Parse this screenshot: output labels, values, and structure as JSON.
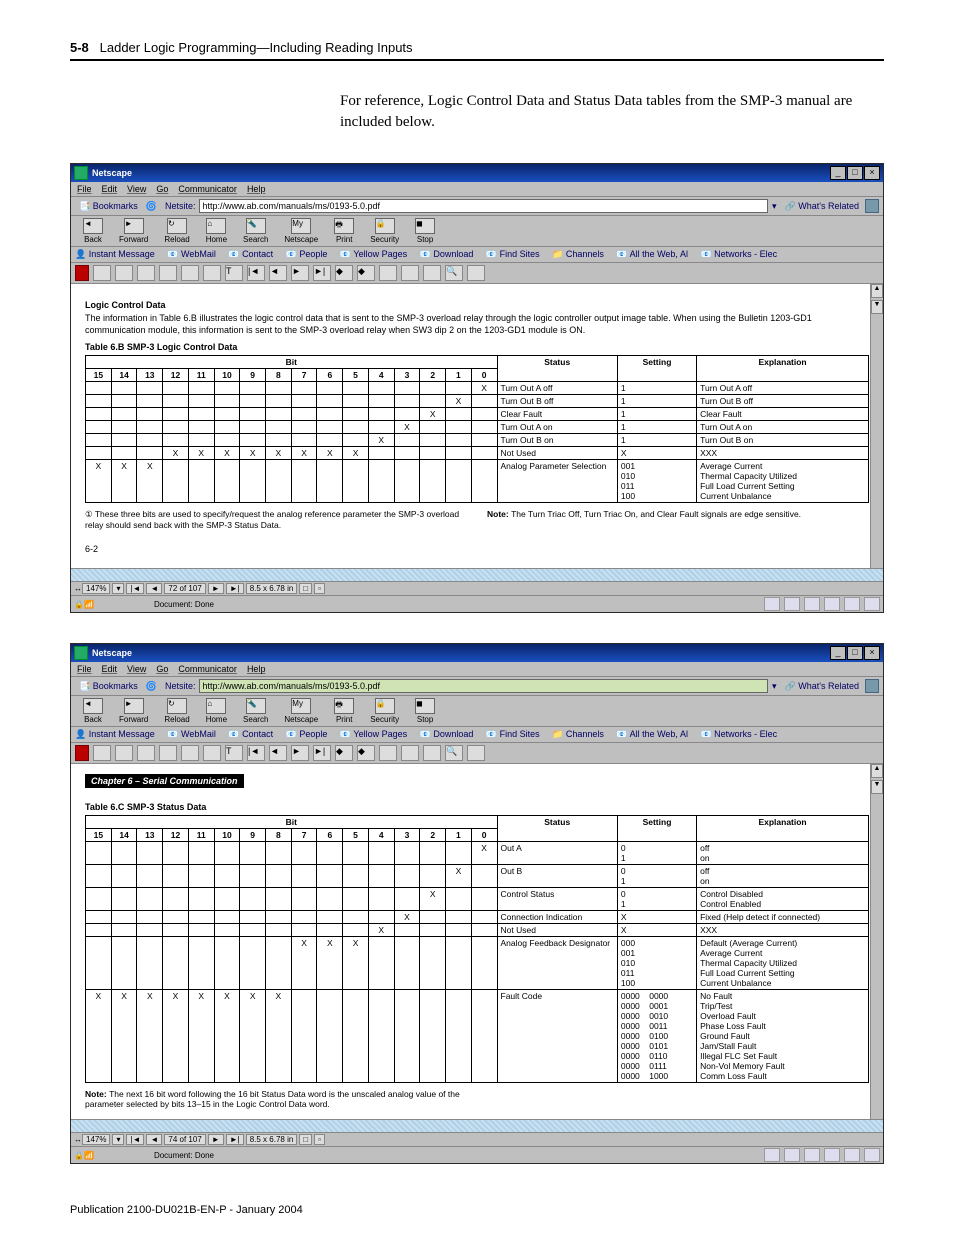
{
  "header": {
    "pagenum": "5-8",
    "title": "Ladder Logic Programming—Including Reading Inputs"
  },
  "intro": "For reference, Logic Control Data and Status Data tables from the SMP-3 manual are included below.",
  "browser": {
    "title": "Netscape",
    "menus": [
      "File",
      "Edit",
      "View",
      "Go",
      "Communicator",
      "Help"
    ],
    "bookmarks": "Bookmarks",
    "netsite_label": "Netsite:",
    "netsite": "http://www.ab.com/manuals/ms/0193-5.0.pdf",
    "related": "What's Related",
    "navbtns": [
      "Back",
      "Forward",
      "Reload",
      "Home",
      "Search",
      "Netscape",
      "Print",
      "Security",
      "Stop"
    ],
    "linkbar1": [
      "Instant Message",
      "WebMail",
      "Contact",
      "People",
      "Yellow Pages",
      "Download",
      "Find Sites",
      "Channels",
      "All the Web, Al",
      "Networks - Elec"
    ],
    "docdone": "Document: Done"
  },
  "win1": {
    "heading": "Logic Control Data",
    "desc": "The information in Table 6.B illustrates the logic control data that is sent to the SMP-3 overload relay through the logic controller output image table. When using the Bulletin 1203-GD1 communication module, this information is sent to the SMP-3 overload relay when SW3 dip 2 on the 1203-GD1 module is ON.",
    "caption": "Table 6.B SMP-3 Logic Control Data",
    "footnote": "① These three bits are used to specify/request the analog reference parameter the SMP-3 overload relay should send back with the SMP-3 Status Data.",
    "rnote_label": "Note:",
    "rnote": "The Turn Triac Off, Turn Triac On, and Clear Fault signals are edge sensitive.",
    "pagelabel": "6-2",
    "statnav": "72 of 107",
    "zoom": "147%",
    "pagesize": "8.5 x 6.78 in",
    "bitlabel": "Bit",
    "cols": {
      "status": "Status",
      "setting": "Setting",
      "expl": "Explanation"
    },
    "rows": [
      {
        "bits": {
          "0": "X"
        },
        "status": "Turn Out A off",
        "setting": "1",
        "expl": "Turn Out A off"
      },
      {
        "bits": {
          "1": "X"
        },
        "status": "Turn Out B off",
        "setting": "1",
        "expl": "Turn Out B off"
      },
      {
        "bits": {
          "2": "X"
        },
        "status": "Clear Fault",
        "setting": "1",
        "expl": "Clear Fault"
      },
      {
        "bits": {
          "3": "X"
        },
        "status": "Turn Out A on",
        "setting": "1",
        "expl": "Turn Out A on"
      },
      {
        "bits": {
          "4": "X"
        },
        "status": "Turn Out B on",
        "setting": "1",
        "expl": "Turn Out B on"
      },
      {
        "bits": {
          "5": "X",
          "6": "X",
          "7": "X",
          "8": "X",
          "9": "X",
          "10": "X",
          "11": "X",
          "12": "X"
        },
        "status": "Not Used",
        "setting": "X",
        "expl": "XXX"
      },
      {
        "bits": {
          "13": "X",
          "14": "X",
          "15": "X"
        },
        "status": "Analog Parameter Selection",
        "setting": "001\n010\n011\n100",
        "expl": "Average Current\nThermal Capacity Utilized\nFull Load Current Setting\nCurrent Unbalance"
      }
    ]
  },
  "win2": {
    "chapter": "Chapter 6 – Serial Communication",
    "caption": "Table 6.C SMP-3 Status Data",
    "note_label": "Note:",
    "note": "The next 16 bit word following the 16 bit Status Data word is the unscaled analog value of the parameter selected by bits 13–15 in the Logic Control Data word.",
    "statnav": "74 of 107",
    "zoom": "147%",
    "pagesize": "8.5 x 6.78 in",
    "bitlabel": "Bit",
    "cols": {
      "status": "Status",
      "setting": "Setting",
      "expl": "Explanation"
    },
    "rows": [
      {
        "bits": {
          "0": "X"
        },
        "status": "Out A",
        "setting": "0\n1",
        "expl": "off\non"
      },
      {
        "bits": {
          "1": "X"
        },
        "status": "Out B",
        "setting": "0\n1",
        "expl": "off\non"
      },
      {
        "bits": {
          "2": "X"
        },
        "status": "Control Status",
        "setting": "0\n1",
        "expl": "Control Disabled\nControl Enabled"
      },
      {
        "bits": {
          "3": "X"
        },
        "status": "Connection Indication",
        "setting": "X",
        "expl": "Fixed (Help detect if connected)"
      },
      {
        "bits": {
          "4": "X"
        },
        "status": "Not Used",
        "setting": "X",
        "expl": "XXX"
      },
      {
        "bits": {
          "5": "X",
          "6": "X",
          "7": "X"
        },
        "status": "Analog Feedback Designator",
        "setting": "000\n001\n010\n011\n100",
        "expl": "Default (Average Current)\nAverage Current\nThermal Capacity Utilized\nFull Load Current Setting\nCurrent Unbalance"
      },
      {
        "bits": {
          "8": "X",
          "9": "X",
          "10": "X",
          "11": "X",
          "12": "X",
          "13": "X",
          "14": "X",
          "15": "X"
        },
        "status": "Fault Code",
        "setting": "0000    0000\n0000    0001\n0000    0010\n0000    0011\n0000    0100\n0000    0101\n0000    0110\n0000    0111\n0000    1000",
        "expl": "No Fault\nTrip/Test\nOverload Fault\nPhase Loss Fault\nGround Fault\nJam/Stall Fault\nIllegal FLC Set Fault\nNon-Vol Memory Fault\nComm Loss Fault"
      }
    ]
  },
  "footer": "Publication 2100-DU021B-EN-P - January 2004"
}
